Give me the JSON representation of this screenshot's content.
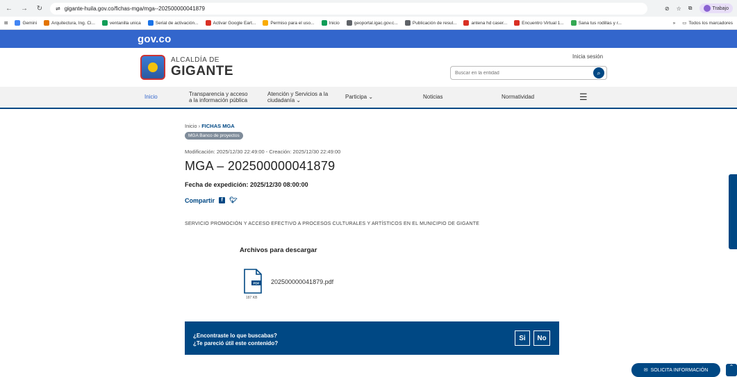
{
  "browser": {
    "url": "gigante-huila.gov.co/fichas-mga/mga--202500000041879",
    "profile_label": "Trabajo",
    "profile_initial": "P"
  },
  "bookmarks": [
    {
      "label": "Gemini",
      "color": "#4285f4"
    },
    {
      "label": "Arquitectura, Ing. Ci...",
      "color": "#e37400"
    },
    {
      "label": "ventanilla unica",
      "color": "#0f9d58"
    },
    {
      "label": "Serial de activación...",
      "color": "#1a73e8"
    },
    {
      "label": "Activar Google Eart...",
      "color": "#d93025"
    },
    {
      "label": "Permiso para el uso...",
      "color": "#f9ab00"
    },
    {
      "label": "Inicio",
      "color": "#0f9d58"
    },
    {
      "label": "geoportal.igac.gov.c...",
      "color": "#5f6368"
    },
    {
      "label": "Publicación de resul...",
      "color": "#5f6368"
    },
    {
      "label": "antena hd caser...",
      "color": "#d93025"
    },
    {
      "label": "Encuentro Virtual 1...",
      "color": "#d93025"
    },
    {
      "label": "Sana tus rodillas y r...",
      "color": "#34a853"
    }
  ],
  "bookmarks_overflow": "»",
  "bookmarks_all": "Todos los marcadores",
  "gov_brand": "ɡov.co",
  "logo": {
    "small": "ALCALDÍA DE",
    "big": "GIGANTE"
  },
  "login_label": "Inicia sesión",
  "search": {
    "placeholder": "Buscar en la entidad"
  },
  "nav": {
    "inicio": "Inicio",
    "transparencia_1": "Transparencia y acceso",
    "transparencia_2": "a la información pública",
    "atencion_1": "Atención y Servicios a la",
    "atencion_2": "ciudadanía",
    "participa": "Participa",
    "noticias": "Noticias",
    "normatividad": "Normatividad"
  },
  "breadcrumb": {
    "home": "Inicio",
    "sep": "›",
    "current": "FICHAS MGA"
  },
  "tag": "MGA Banco de proyectos",
  "meta": "Modificación: 2025/12/30 22:49:00 - Creación: 2025/12/30 22:49:00",
  "title": "MGA – 202500000041879",
  "fecha": "Fecha de expedición: 2025/12/30 08:00:00",
  "share_label": "Compartir",
  "description": "SERVICIO PROMOCIÓN Y ACCESO EFECTIVO A PROCESOS CULTURALES Y ARTÍSTICOS EN EL MUNICIPIO DE GIGANTE",
  "files": {
    "title": "Archivos para descargar",
    "items": [
      {
        "name": "202500000041879.pdf",
        "size": "187 KB",
        "type_label": "PDF"
      }
    ]
  },
  "feedback": {
    "q1": "¿Encontraste lo que buscabas?",
    "q2": "¿Te pareció útil este contenido?",
    "yes": "Si",
    "no": "No"
  },
  "solicita": "SOLICITA INFORMACIÓN",
  "colors": {
    "gov_blue": "#3366cc",
    "primary": "#004884"
  }
}
